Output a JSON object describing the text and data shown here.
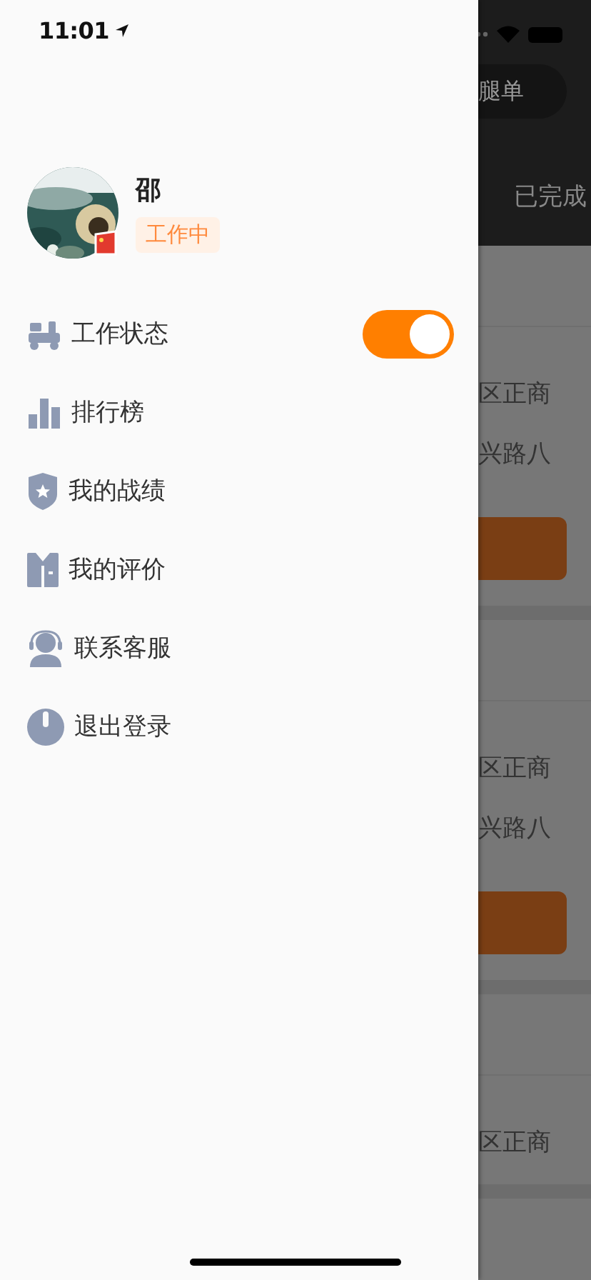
{
  "status_bar": {
    "time": "11:01"
  },
  "profile": {
    "name": "邵",
    "status": "工作中"
  },
  "menu": [
    {
      "kind": "toggle",
      "label": "工作状态",
      "on": true
    },
    {
      "kind": "link",
      "label": "排行榜"
    },
    {
      "kind": "link",
      "label": "我的战绩"
    },
    {
      "kind": "link",
      "label": "我的评价"
    },
    {
      "kind": "link",
      "label": "联系客服"
    },
    {
      "kind": "link",
      "label": "退出登录"
    }
  ],
  "background": {
    "pill": "腿单",
    "tab": "已完成",
    "orders": [
      {
        "line_1": "区正商",
        "line_2": "兴路八"
      },
      {
        "line_1": "区正商",
        "line_2": "兴路八"
      },
      {
        "line_1": "区正商"
      }
    ]
  }
}
